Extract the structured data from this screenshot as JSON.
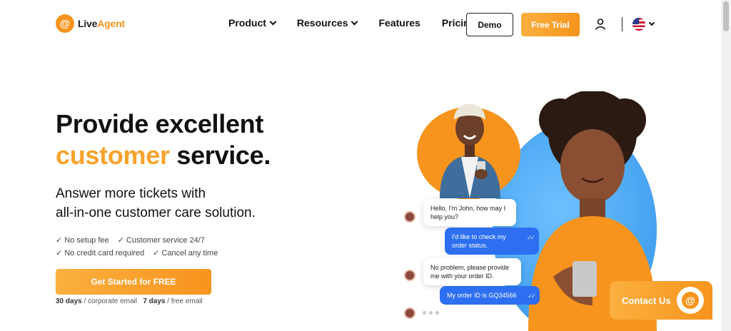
{
  "header": {
    "logo_symbol": "@",
    "logo_text_a": "Live",
    "logo_text_b": "Agent",
    "nav": [
      {
        "label": "Product",
        "has_dropdown": true
      },
      {
        "label": "Resources",
        "has_dropdown": true
      },
      {
        "label": "Features",
        "has_dropdown": false
      },
      {
        "label": "Pricing",
        "has_dropdown": false
      }
    ],
    "demo_label": "Demo",
    "trial_label": "Free Trial",
    "user_icon": "user-icon",
    "language_icon": "us-flag-icon"
  },
  "hero": {
    "title_line1": "Provide excellent",
    "title_highlight": "customer",
    "title_rest": " service.",
    "subtitle_line1": "Answer more tickets with",
    "subtitle_line2": "all-in-one customer care solution.",
    "checks": [
      "✓ No setup fee",
      "✓ Customer service 24/7",
      "✓ No credit card required",
      "✓ Cancel any time"
    ],
    "cta_label": "Get Started for FREE",
    "note_days1": "30 days",
    "note_text1": " / corporate email",
    "note_days2": "7 days",
    "note_text2": " / free email"
  },
  "chat": {
    "messages": [
      {
        "text": "Hello, I'm John, how may I help you?",
        "from": "agent"
      },
      {
        "text": "I'd like to check my order status.",
        "from": "customer"
      },
      {
        "text": "No problem, please provide me with your order ID.",
        "from": "agent"
      },
      {
        "text": "My order ID is GQ34566",
        "from": "customer"
      }
    ],
    "read_mark": "✓✓"
  },
  "contact": {
    "label": "Contact Us",
    "icon_symbol": "@"
  },
  "colors": {
    "brand_orange": "#f7941d",
    "chat_blue": "#2d6ff0",
    "accent_blue": "#2d8fe8"
  }
}
